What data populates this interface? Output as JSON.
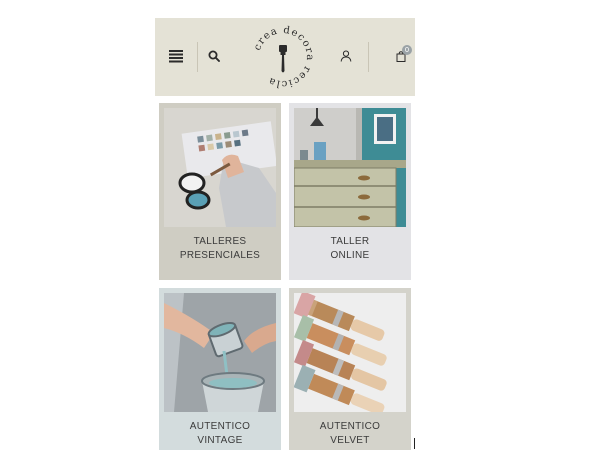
{
  "header": {
    "logo_text": "crea decora recicla",
    "cart_count": "0"
  },
  "icons": {
    "menu": "hamburger-menu-icon",
    "search": "search-icon",
    "user": "user-icon",
    "cart": "shopping-bag-icon",
    "logo": "paint-brush-icon"
  },
  "cards": [
    {
      "line1": "TALLERES",
      "line2": "PRESENCIALES"
    },
    {
      "line1": "TALLER",
      "line2": "ONLINE"
    },
    {
      "line1": "AUTENTICO",
      "line2": "VINTAGE"
    },
    {
      "line1": "AUTENTICO",
      "line2": "VELVET"
    }
  ],
  "colors": {
    "header_bg": "#e4e2d6",
    "card1_bg": "#cfcdc3",
    "card2_bg": "#e3e3e6",
    "card3_bg": "#d3dcdd",
    "card4_bg": "#d4d3cb"
  }
}
